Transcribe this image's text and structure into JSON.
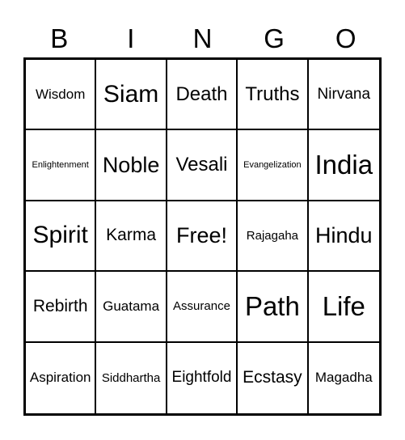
{
  "header": {
    "letters": [
      "B",
      "I",
      "N",
      "G",
      "O"
    ]
  },
  "grid": {
    "rows": [
      [
        "Wisdom",
        "Siam",
        "Death",
        "Truths",
        "Nirvana"
      ],
      [
        "Enlightenment",
        "Noble",
        "Vesali",
        "Evangelization",
        "India"
      ],
      [
        "Spirit",
        "Karma",
        "Free!",
        "Rajagaha",
        "Hindu"
      ],
      [
        "Rebirth",
        "Guatama",
        "Assurance",
        "Path",
        "Life"
      ],
      [
        "Aspiration",
        "Siddhartha",
        "Eightfold",
        "Ecstasy",
        "Magadha"
      ]
    ]
  }
}
